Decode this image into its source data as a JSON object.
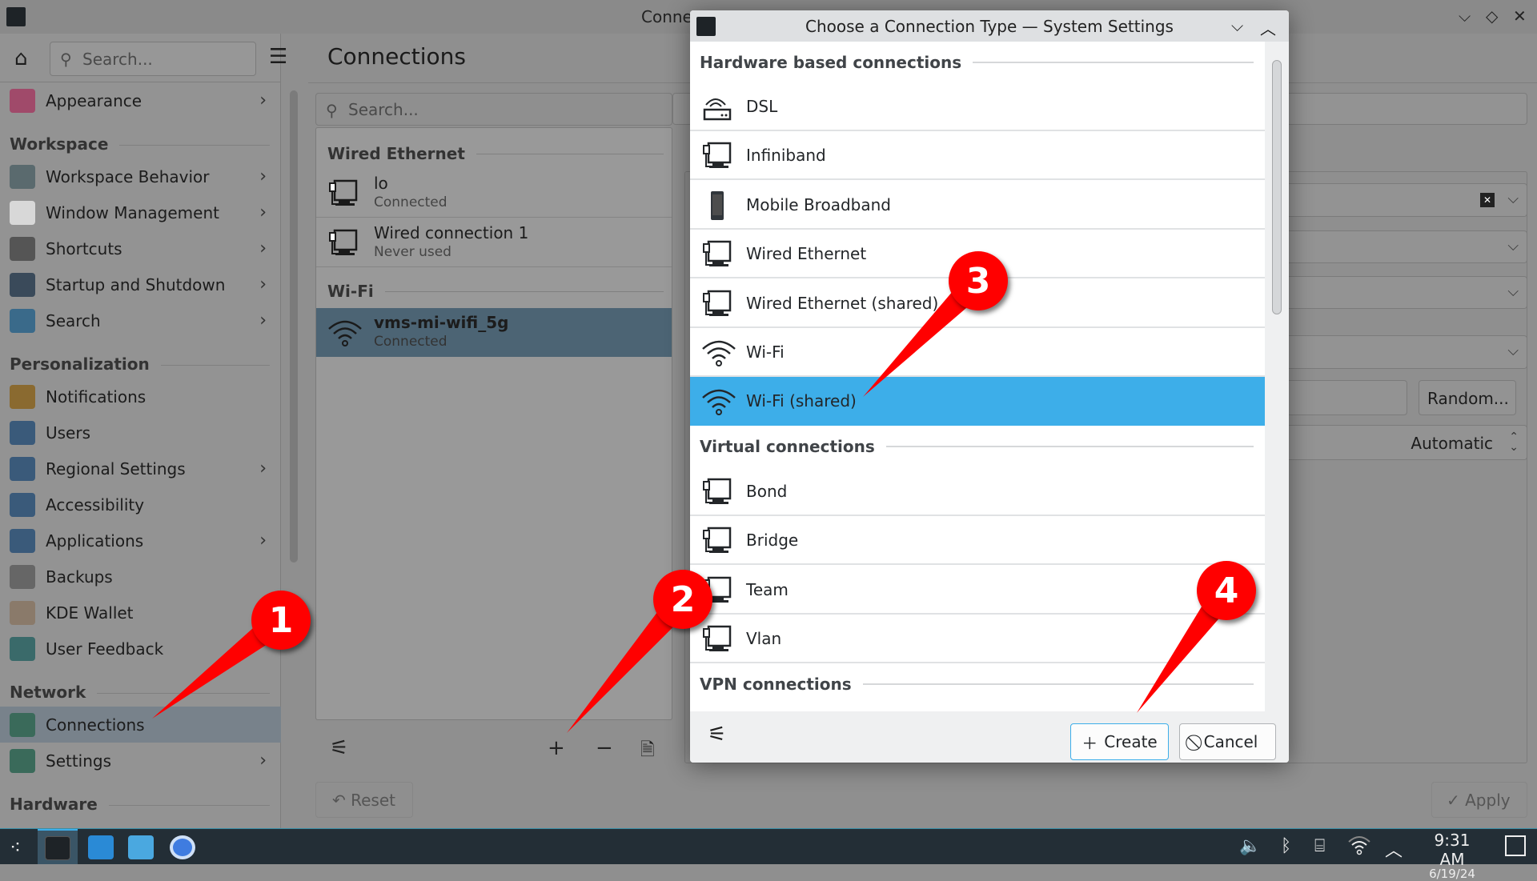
{
  "window": {
    "title": "Conne",
    "controls": [
      "minimize",
      "maximize",
      "close"
    ]
  },
  "sidebar": {
    "search_placeholder": "Search...",
    "items": [
      {
        "type": "item",
        "label": "Appearance",
        "chevron": true,
        "color": "#a04a6a"
      },
      {
        "type": "header",
        "label": "Workspace"
      },
      {
        "type": "item",
        "label": "Workspace Behavior",
        "chevron": true,
        "color": "#5a6a6e"
      },
      {
        "type": "item",
        "label": "Window Management",
        "chevron": true,
        "color": "#d8d8d8"
      },
      {
        "type": "item",
        "label": "Shortcuts",
        "chevron": true,
        "color": "#555"
      },
      {
        "type": "item",
        "label": "Startup and Shutdown",
        "chevron": true,
        "color": "#3a4a5a"
      },
      {
        "type": "item",
        "label": "Search",
        "chevron": true,
        "color": "#3a6a8a"
      },
      {
        "type": "header",
        "label": "Personalization"
      },
      {
        "type": "item",
        "label": "Notifications",
        "chevron": false,
        "color": "#8a6a30"
      },
      {
        "type": "item",
        "label": "Users",
        "chevron": false,
        "color": "#3a5a7a"
      },
      {
        "type": "item",
        "label": "Regional Settings",
        "chevron": true,
        "color": "#3a5a7a"
      },
      {
        "type": "item",
        "label": "Accessibility",
        "chevron": false,
        "color": "#3a5a7a"
      },
      {
        "type": "item",
        "label": "Applications",
        "chevron": true,
        "color": "#3a5a7a"
      },
      {
        "type": "item",
        "label": "Backups",
        "chevron": false,
        "color": "#666"
      },
      {
        "type": "item",
        "label": "KDE Wallet",
        "chevron": false,
        "color": "#8a7a6a"
      },
      {
        "type": "item",
        "label": "User Feedback",
        "chevron": false,
        "color": "#3a6a6a"
      },
      {
        "type": "header",
        "label": "Network"
      },
      {
        "type": "item",
        "label": "Connections",
        "chevron": false,
        "selected": true,
        "color": "#3a6a5a"
      },
      {
        "type": "item",
        "label": "Settings",
        "chevron": true,
        "color": "#3a6a5a"
      },
      {
        "type": "header",
        "label": "Hardware"
      }
    ]
  },
  "content": {
    "title": "Connections",
    "search_placeholder": "Search...",
    "groups": [
      {
        "header": "Wired Ethernet",
        "rows": [
          {
            "name": "lo",
            "status": "Connected"
          },
          {
            "name": "Wired connection 1",
            "status": "Never used"
          }
        ]
      },
      {
        "header": "Wi-Fi",
        "rows": [
          {
            "name": "vms-mi-wifi_5g",
            "status": "Connected",
            "selected": true
          }
        ]
      }
    ],
    "reset_label": "Reset",
    "apply_label": "Apply",
    "random_label": "Random...",
    "automatic_label": "Automatic"
  },
  "dialog": {
    "title": "Choose a Connection Type — System Settings",
    "sections": [
      {
        "header": "Hardware based connections",
        "items": [
          {
            "label": "DSL",
            "icon": "dsl-icon"
          },
          {
            "label": "Infiniband",
            "icon": "network-wired-icon"
          },
          {
            "label": "Mobile Broadband",
            "icon": "phone-icon"
          },
          {
            "label": "Wired Ethernet",
            "icon": "network-wired-icon"
          },
          {
            "label": "Wired Ethernet (shared)",
            "icon": "network-wired-icon"
          },
          {
            "label": "Wi-Fi",
            "icon": "wifi-icon"
          },
          {
            "label": "Wi-Fi (shared)",
            "icon": "wifi-icon",
            "selected": true
          }
        ]
      },
      {
        "header": "Virtual connections",
        "items": [
          {
            "label": "Bond",
            "icon": "network-wired-icon"
          },
          {
            "label": "Bridge",
            "icon": "network-wired-icon"
          },
          {
            "label": "Team",
            "icon": "network-wired-icon"
          },
          {
            "label": "Vlan",
            "icon": "network-wired-icon"
          }
        ]
      },
      {
        "header": "VPN connections",
        "items": []
      }
    ],
    "create_label": "Create",
    "cancel_label": "Cancel",
    "accent": "#3daee9"
  },
  "annotations": [
    "1",
    "2",
    "3",
    "4"
  ],
  "taskbar": {
    "time": "9:31 AM",
    "date": "6/19/24"
  }
}
